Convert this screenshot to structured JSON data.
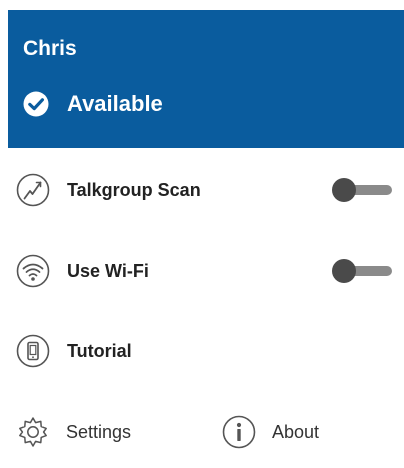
{
  "header": {
    "user_name": "Chris",
    "status_label": "Available",
    "status_icon": "check-circle-icon"
  },
  "menu": {
    "items": [
      {
        "label": "Talkgroup Scan",
        "icon": "scan-icon",
        "toggle": true,
        "toggle_on": false
      },
      {
        "label": "Use Wi-Fi",
        "icon": "wifi-icon",
        "toggle": true,
        "toggle_on": false
      },
      {
        "label": "Tutorial",
        "icon": "tutorial-icon",
        "toggle": false
      }
    ]
  },
  "footer": {
    "settings_label": "Settings",
    "settings_icon": "gear-icon",
    "about_label": "About",
    "about_icon": "info-icon"
  },
  "colors": {
    "header_bg": "#0a5c9e",
    "header_text": "#ffffff",
    "toggle_thumb_off": "#4a4a4a",
    "toggle_track_off": "#8a8a8a"
  }
}
